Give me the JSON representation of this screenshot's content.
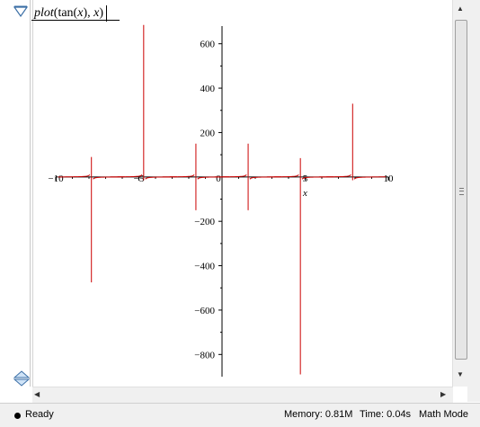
{
  "worksheet": {
    "command_parts": {
      "plot_fn": "plot",
      "open": "(tan(",
      "var1": "x",
      "mid": "), ",
      "var2": "x",
      "close": ")"
    }
  },
  "status": {
    "ready": "Ready",
    "memory": "Memory: 0.81M",
    "time": "Time: 0.04s",
    "mode": "Math Mode"
  },
  "chart_data": {
    "type": "line",
    "function": "tan(x)",
    "xlabel": "x",
    "ylabel": "",
    "xlim": [
      -10,
      10
    ],
    "ylim": [
      -900,
      700
    ],
    "x_ticks": [
      -10,
      -5,
      0,
      5,
      10
    ],
    "x_tick_labels": [
      "−10",
      "−5",
      "0",
      "5",
      "10"
    ],
    "y_ticks": [
      -800,
      -600,
      -400,
      -200,
      200,
      400,
      600
    ],
    "y_tick_labels": [
      "−800",
      "−600",
      "−400",
      "−200",
      "200",
      "400",
      "600"
    ],
    "series": [
      {
        "color": "#cc0000",
        "spikes": [
          {
            "x": -7.854,
            "top": 90,
            "bottom": -475
          },
          {
            "x": -4.712,
            "top": 685,
            "bottom": -15
          },
          {
            "x": -1.571,
            "top": 150,
            "bottom": -150
          },
          {
            "x": 1.571,
            "top": 150,
            "bottom": -150
          },
          {
            "x": 4.712,
            "top": 85,
            "bottom": -890
          },
          {
            "x": 7.854,
            "top": 330,
            "bottom": -15
          }
        ]
      }
    ],
    "grid": false
  },
  "icons": {
    "collapse": "triangle-down-icon",
    "split": "split-pane-icon",
    "scroll_up": "arrow-up-icon",
    "scroll_down": "arrow-down-icon",
    "scroll_left": "arrow-left-icon",
    "scroll_right": "arrow-right-icon"
  }
}
